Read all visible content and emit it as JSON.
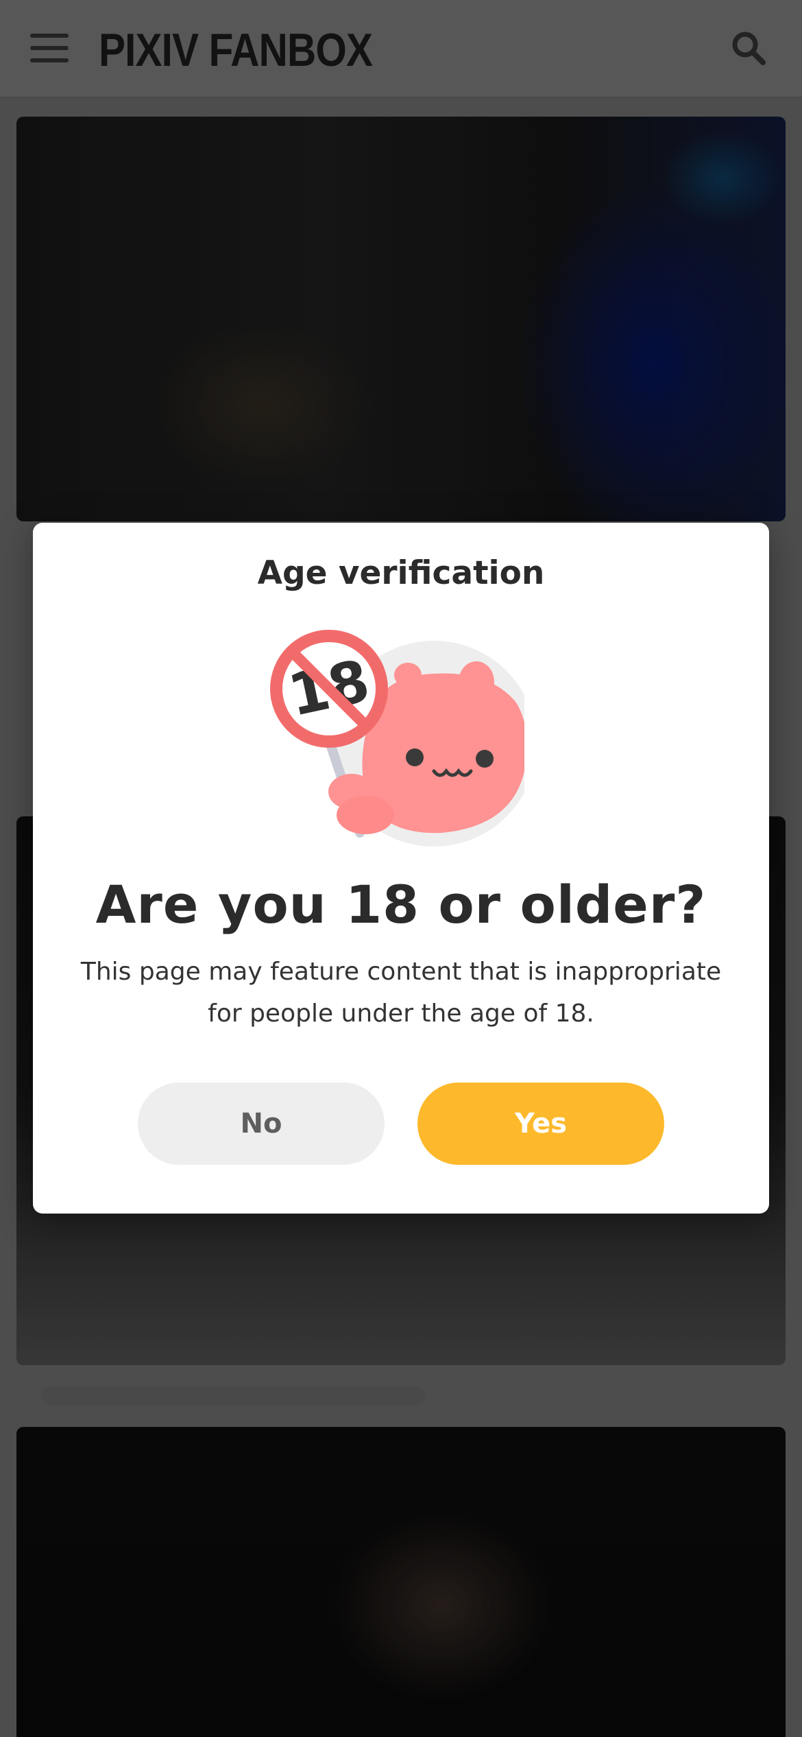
{
  "header": {
    "logo_text": "PIXIV FANBOX",
    "menu_icon": "hamburger-menu-icon",
    "search_icon": "search-icon"
  },
  "dialog": {
    "title": "Age verification",
    "illustration": "mascot-holding-no-18-sign",
    "question": "Are you 18 or older?",
    "description": "This page may feature content that is inappropriate for people under the age of 18.",
    "no_label": "No",
    "yes_label": "Yes"
  },
  "colors": {
    "accent_yes": "#fdb92b",
    "button_no": "#eeeeee",
    "mascot_pink": "#ff9292",
    "sign_red": "#f26b6b"
  }
}
